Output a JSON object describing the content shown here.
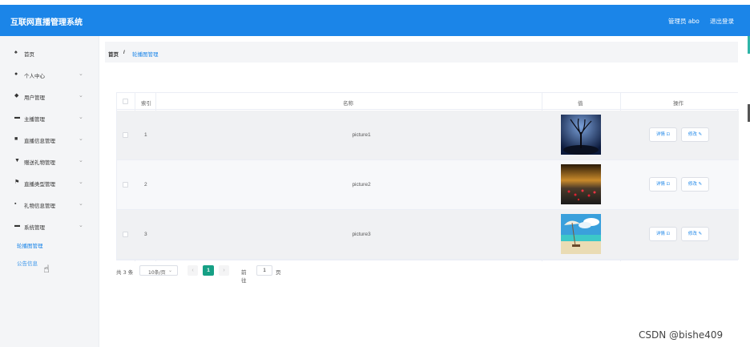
{
  "header": {
    "title": "互联网直播管理系统",
    "admin_label": "管理员 abo",
    "logout_label": "退出登录"
  },
  "sidebar": {
    "items": [
      {
        "label": "首页",
        "icon": "home-icon",
        "glyph": "♠"
      },
      {
        "label": "个人中心",
        "icon": "user-icon",
        "glyph": "●"
      },
      {
        "label": "用户管理",
        "icon": "location-icon",
        "glyph": "◆"
      },
      {
        "label": "主播管理",
        "icon": "briefcase-icon",
        "glyph": "▬"
      },
      {
        "label": "直播信息管理",
        "icon": "list-icon",
        "glyph": "■"
      },
      {
        "label": "赠送礼物管理",
        "icon": "shield-icon",
        "glyph": "▼"
      },
      {
        "label": "直播类型管理",
        "icon": "flag-icon",
        "glyph": "⚑"
      },
      {
        "label": "礼物信息管理",
        "icon": "grid-icon",
        "glyph": "▪"
      },
      {
        "label": "系统管理",
        "icon": "settings-icon",
        "glyph": "▬"
      }
    ],
    "chevron": "⌄",
    "subitems": [
      {
        "label": "轮播图管理"
      },
      {
        "label": "公告信息"
      }
    ]
  },
  "breadcrumb": {
    "home": "首页",
    "separator": "/",
    "current": "轮播图管理"
  },
  "table": {
    "columns": {
      "index": "索引",
      "name": "名称",
      "value": "值",
      "actions": "操作"
    },
    "rows": [
      {
        "index": "1",
        "name": "picture1",
        "image": "tree-night-image",
        "detail": "详情 ⊡",
        "edit": "修改 ✎"
      },
      {
        "index": "2",
        "name": "picture2",
        "image": "flowers-dark-image",
        "detail": "详情 ⊡",
        "edit": "修改 ✎"
      },
      {
        "index": "3",
        "name": "picture3",
        "image": "beach-umbrella-image",
        "detail": "详情 ⊡",
        "edit": "修改 ✎"
      }
    ]
  },
  "pagination": {
    "total": "共 3 条",
    "page_size": "10条/页",
    "prev": "‹",
    "current_page": "1",
    "next": "›",
    "goto_label": "前往",
    "goto_value": "1",
    "goto_unit": "页"
  },
  "watermark": "CSDN @bishe409",
  "colors": {
    "header": "#1b85e8",
    "accent": "#1b85e8",
    "active_page": "#16a085"
  }
}
